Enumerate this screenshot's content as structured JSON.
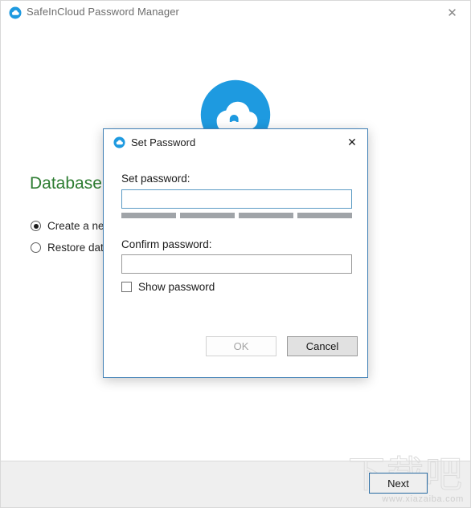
{
  "window": {
    "title": "SafeInCloud Password Manager",
    "icon": "cloud-icon",
    "close_label": "✕"
  },
  "content": {
    "logo": "safeincloud-cloud-logo",
    "heading": "Database",
    "options": [
      {
        "label": "Create a new database",
        "selected": true
      },
      {
        "label": "Restore database from backup",
        "selected": false
      }
    ]
  },
  "footer": {
    "next_label": "Next"
  },
  "watermark": {
    "cjk": "下载吧",
    "url": "www.xiazaiba.com"
  },
  "dialog": {
    "title": "Set Password",
    "icon": "cloud-icon",
    "close_label": "✕",
    "set_password": {
      "label": "Set password:",
      "value": "",
      "placeholder": ""
    },
    "strength": {
      "segments": 4,
      "filled": 0,
      "empty_color": "#a0a4a8"
    },
    "confirm_password": {
      "label": "Confirm password:",
      "value": "",
      "placeholder": ""
    },
    "show_password": {
      "label": "Show password",
      "checked": false
    },
    "buttons": {
      "ok": "OK",
      "ok_enabled": false,
      "cancel": "Cancel",
      "cancel_enabled": true
    }
  },
  "colors": {
    "brand_blue": "#1e9ae0",
    "heading_green": "#2e7d32",
    "dialog_border": "#3f7fb5",
    "focus_border": "#2c6ea5",
    "footer_bg": "#efefef"
  }
}
